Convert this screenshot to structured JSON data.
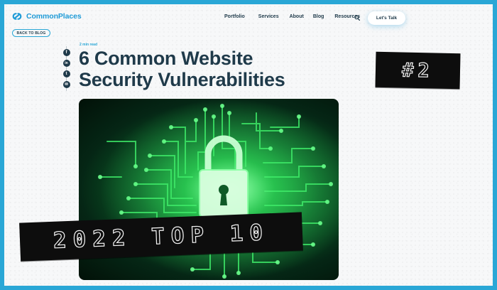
{
  "header": {
    "logo_text": "CommonPlaces",
    "nav": [
      "Portfolio",
      "Services",
      "About",
      "Blog",
      "Resources"
    ],
    "cta_label": "Let's Talk"
  },
  "back_label": "BACK TO BLOG",
  "article": {
    "read_time": "2 min read",
    "title_line1": "6 Common Website",
    "title_line2": "Security Vulnerabilities",
    "share": [
      {
        "glyph": "f",
        "icon": "facebook-icon"
      },
      {
        "glyph": "in",
        "icon": "linkedin-icon"
      },
      {
        "glyph": "t",
        "icon": "twitter-icon"
      },
      {
        "glyph": "✉",
        "icon": "email-icon"
      }
    ]
  },
  "stamps": {
    "rank": "#2",
    "ranking": "2022 TOP 10"
  },
  "colors": {
    "brand": "#1f9bd7",
    "navy": "#1f3a4a",
    "frame": "#2aa7d6",
    "circuit_green": "#36e05f"
  }
}
